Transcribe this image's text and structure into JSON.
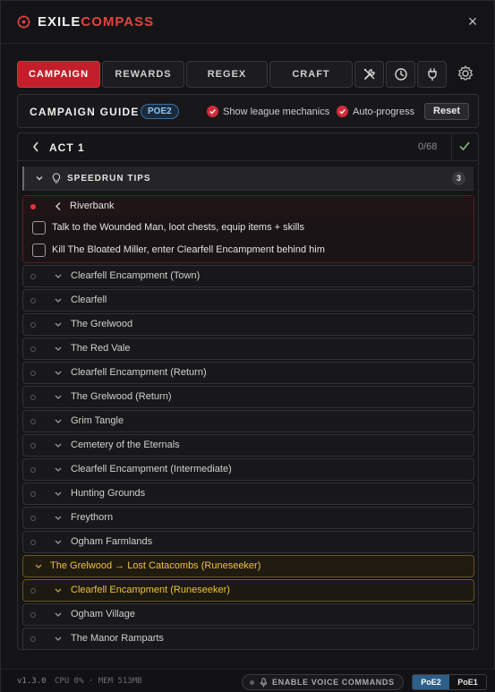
{
  "app": {
    "brand_part1": "EXILE",
    "brand_part2": "COMPASS",
    "close_label": "×"
  },
  "tabs": [
    {
      "label": "CAMPAIGN",
      "active": true
    },
    {
      "label": "REWARDS",
      "active": false
    },
    {
      "label": "REGEX",
      "active": false
    },
    {
      "label": "CRAFT",
      "active": false
    }
  ],
  "tool_tabs": [
    "tools-icon",
    "clock-icon",
    "plug-icon"
  ],
  "guide": {
    "title": "CAMPAIGN GUIDE",
    "badge": "POE2",
    "option_league": "Show league mechanics",
    "option_league_checked": true,
    "option_auto": "Auto-progress",
    "option_auto_checked": true,
    "reset_label": "Reset"
  },
  "act": {
    "title": "ACT 1",
    "progress": "0/68",
    "tips_label": "SPEEDRUN TIPS",
    "tips_count": "3"
  },
  "active_zone": {
    "name": "Riverbank",
    "tasks": [
      "Talk to the Wounded Man, loot chests, equip items + skills",
      "Kill The Bloated Miller, enter Clearfell Encampment behind him"
    ]
  },
  "zones": [
    "Clearfell Encampment (Town)",
    "Clearfell",
    "The Grelwood",
    "The Red Vale",
    "Clearfell Encampment (Return)",
    "The Grelwood (Return)",
    "Grim Tangle",
    "Cemetery of the Eternals",
    "Clearfell Encampment (Intermediate)",
    "Hunting Grounds",
    "Freythorn",
    "Ogham Farmlands"
  ],
  "gold_group": {
    "header": "The Grelwood → Lost Catacombs (Runeseeker)",
    "zone": "Clearfell Encampment (Runeseeker)"
  },
  "more_zones": [
    "Ogham Village",
    "The Manor Ramparts"
  ],
  "footer": {
    "version": "v1.3.0",
    "sysinfo": "CPU 0% · MEM 513MB",
    "voice_label": "ENABLE VOICE COMMANDS",
    "ver_options": [
      "PoE2",
      "PoE1"
    ],
    "ver_selected": "PoE2"
  },
  "colors": {
    "accent_red": "#c21f2b",
    "brand_red": "#e0453f",
    "gold": "#f0c040",
    "poe2_blue": "#2d5f88"
  }
}
